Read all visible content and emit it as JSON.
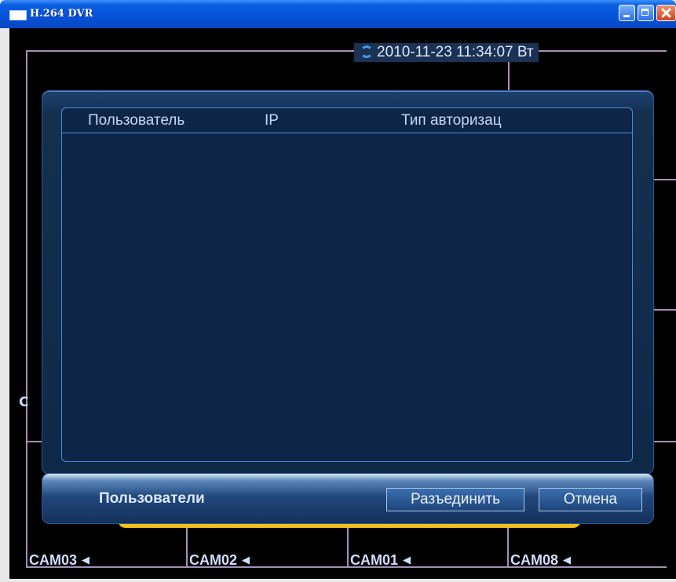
{
  "window": {
    "title": "H.264 DVR"
  },
  "overlay": {
    "datetime": "2010-11-23 11:34:07 Вт",
    "channel_letter": "C"
  },
  "dialog": {
    "columns": [
      "Пользователь",
      "IP",
      "Тип авторизац"
    ],
    "rows": [],
    "footer_title": "Пользователи",
    "disconnect_label": "Разъединить",
    "cancel_label": "Отмена"
  },
  "cameras": [
    "CAM03",
    "CAM02",
    "CAM01",
    "CAM08"
  ],
  "colors": {
    "dialog_bg": "#0e2848",
    "accent_border": "#4a8ad6",
    "highlight": "#f0c020"
  }
}
